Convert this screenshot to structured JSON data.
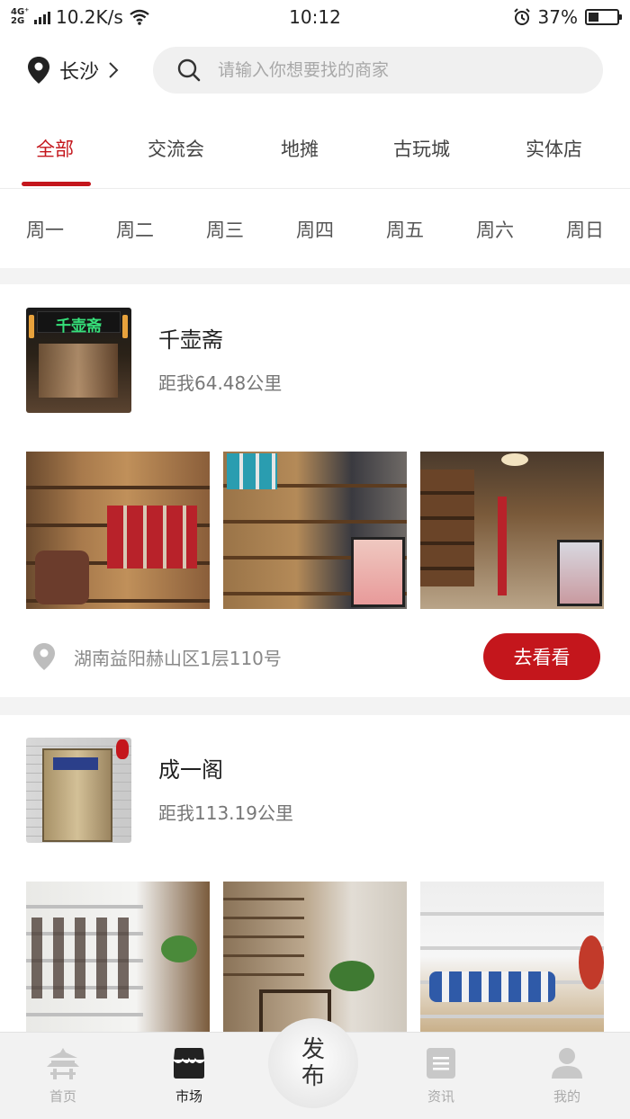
{
  "status_bar": {
    "network": "4G⁺ 2G",
    "speed": "10.2K/s",
    "time": "10:12",
    "battery_text": "37%",
    "battery_level": 0.37
  },
  "header": {
    "city": "长沙",
    "search_placeholder": "请输入你想要找的商家"
  },
  "category_tabs": [
    {
      "label": "全部",
      "active": true
    },
    {
      "label": "交流会",
      "active": false
    },
    {
      "label": "地摊",
      "active": false
    },
    {
      "label": "古玩城",
      "active": false
    },
    {
      "label": "实体店",
      "active": false
    }
  ],
  "weekday_tabs": [
    "周一",
    "周二",
    "周三",
    "周四",
    "周五",
    "周六",
    "周日"
  ],
  "shops": [
    {
      "name": "千壶斋",
      "distance": "距我64.48公里",
      "sign_text": "千壶斋",
      "address": "湖南益阳赫山区1层110号",
      "button": "去看看"
    },
    {
      "name": "成一阁",
      "distance": "距我113.19公里"
    }
  ],
  "bottom_nav": {
    "items": [
      {
        "label": "首页",
        "icon": "pavilion-icon",
        "active": false
      },
      {
        "label": "市场",
        "icon": "shop-icon",
        "active": true
      },
      {
        "label": "资讯",
        "icon": "news-icon",
        "active": false
      },
      {
        "label": "我的",
        "icon": "user-icon",
        "active": false
      }
    ],
    "publish_label": "发布"
  },
  "colors": {
    "accent": "#c4161c",
    "tab_text": "#444444",
    "muted": "#888888",
    "divider": "#f3f3f3"
  }
}
